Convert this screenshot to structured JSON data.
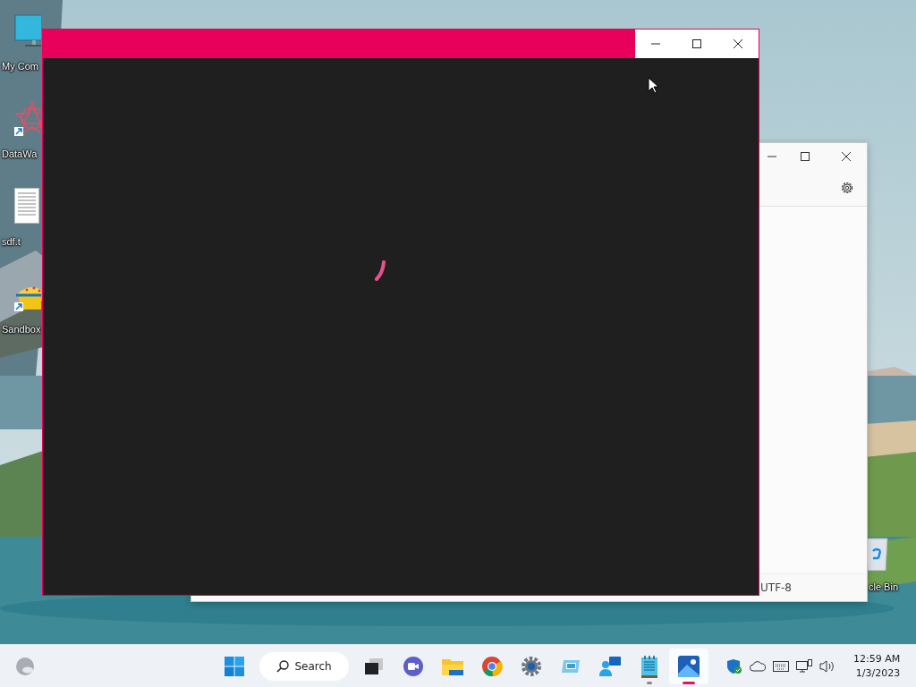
{
  "desktop": {
    "icons": [
      {
        "kind": "monitor",
        "label": "My Com"
      },
      {
        "kind": "star",
        "label": "DataWa"
      },
      {
        "kind": "document",
        "label": "sdf.t"
      },
      {
        "kind": "sandbox",
        "label": "Sandbox"
      }
    ],
    "recycle_bin": {
      "label": "cle Bin"
    }
  },
  "back_window": {
    "status_encoding": "UTF-8"
  },
  "front_window": {
    "loading": true
  },
  "taskbar": {
    "search": "Search",
    "apps": [
      {
        "kind": "taskview",
        "running": false,
        "selected": false
      },
      {
        "kind": "chat",
        "running": false,
        "selected": false
      },
      {
        "kind": "folder",
        "running": false,
        "selected": false
      },
      {
        "kind": "browser",
        "running": false,
        "selected": false
      },
      {
        "kind": "gear",
        "running": false,
        "selected": false
      },
      {
        "kind": "sandbox",
        "running": false,
        "selected": false
      },
      {
        "kind": "people",
        "running": false,
        "selected": false
      },
      {
        "kind": "notepad",
        "running": true,
        "selected": false
      },
      {
        "kind": "photos",
        "running": true,
        "selected": true
      }
    ],
    "clock": {
      "time": "12:59 AM",
      "date": "1/3/2023"
    }
  }
}
